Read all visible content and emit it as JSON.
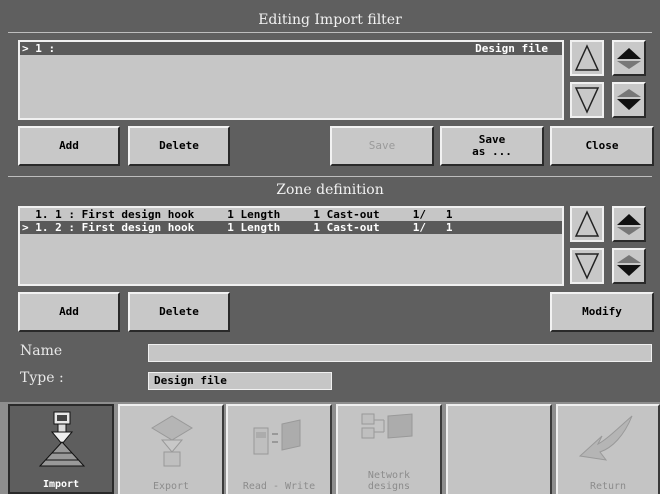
{
  "filter": {
    "title": "Editing Import filter",
    "rows": [
      {
        "index": "> 1 :",
        "name": "Design file",
        "selected": true
      }
    ],
    "buttons": {
      "add": "Add",
      "delete": "Delete",
      "save": "Save",
      "save_as": "Save\nas ...",
      "close": "Close"
    }
  },
  "zone": {
    "title": "Zone definition",
    "rows": [
      {
        "text": "  1. 1 : First design hook     1 Length     1 Cast-out     1/   1",
        "selected": false
      },
      {
        "text": "> 1. 2 : First design hook     1 Length     1 Cast-out     1/   1",
        "selected": true
      }
    ],
    "buttons": {
      "add": "Add",
      "delete": "Delete",
      "modify": "Modify"
    }
  },
  "form": {
    "name_label": "Name",
    "name_value": "",
    "type_label": "Type :",
    "type_value": "Design file"
  },
  "toolbar": {
    "items": [
      {
        "label": "Import",
        "icon": "import-icon",
        "active": true
      },
      {
        "label": "Export",
        "icon": "export-icon",
        "active": false
      },
      {
        "label": "Read - Write",
        "icon": "read-write-icon",
        "active": false
      },
      {
        "label": "Network\ndesigns",
        "icon": "network-designs-icon",
        "active": false
      },
      {
        "label": "",
        "icon": "",
        "active": false
      },
      {
        "label": "Return",
        "icon": "return-icon",
        "active": false
      }
    ]
  },
  "colors": {
    "background": "#5f5f5f",
    "panel": "#c6c6c6",
    "selection": "#5a5a5a"
  }
}
